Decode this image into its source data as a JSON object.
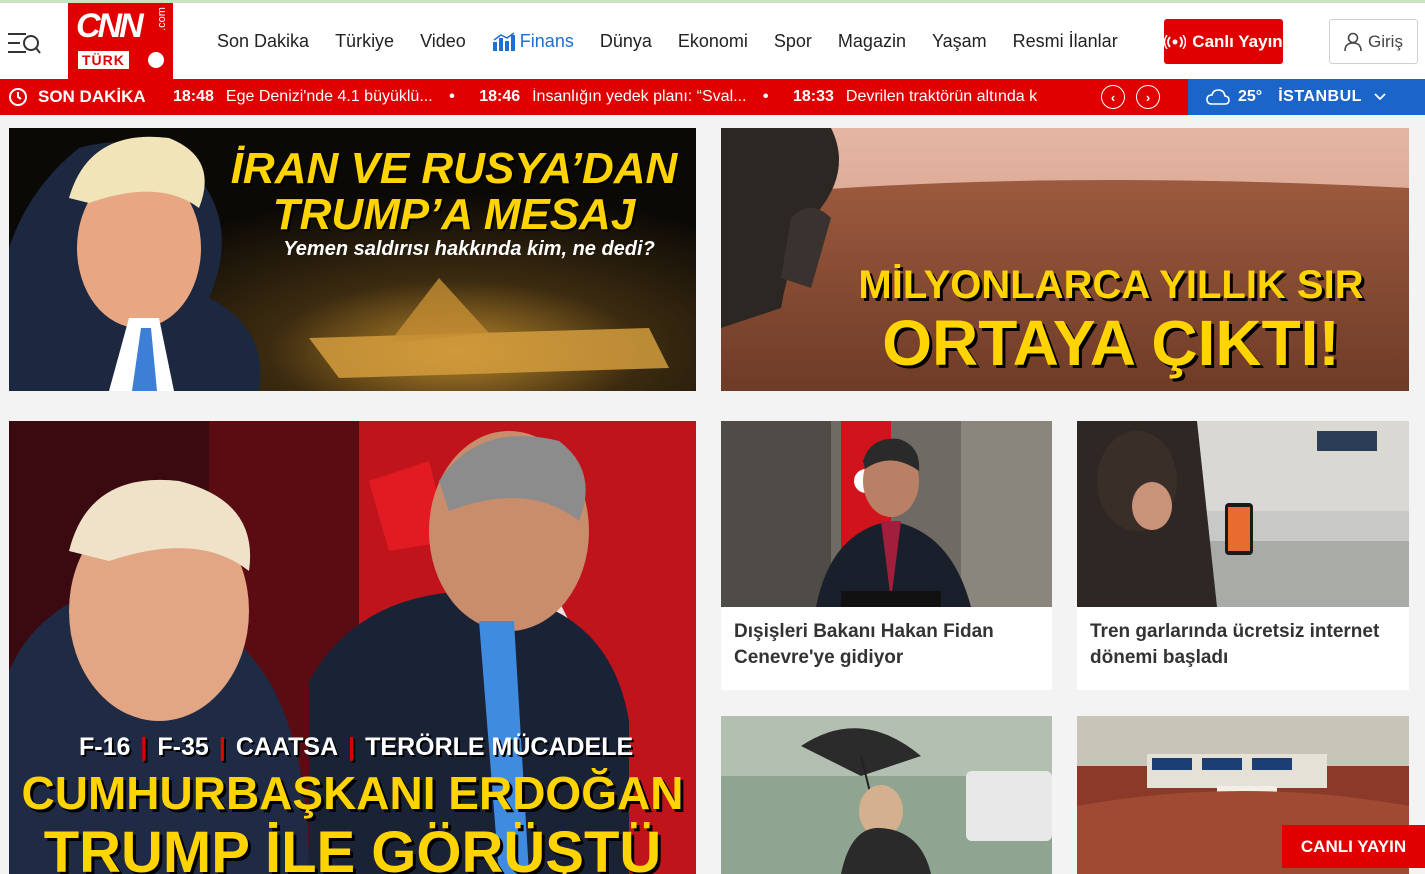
{
  "header": {
    "logo_main": "CNN",
    "logo_sub": "TÜRK",
    "logo_com": ".com",
    "nav": [
      {
        "label": "Son Dakika"
      },
      {
        "label": "Türkiye"
      },
      {
        "label": "Video"
      },
      {
        "label": "Finans"
      },
      {
        "label": "Dünya"
      },
      {
        "label": "Ekonomi"
      },
      {
        "label": "Spor"
      },
      {
        "label": "Magazin"
      },
      {
        "label": "Yaşam"
      },
      {
        "label": "Resmi İlanlar"
      }
    ],
    "live_label": "Canlı Yayın",
    "login_label": "Giriş"
  },
  "ticker": {
    "label": "SON DAKİKA",
    "items": [
      {
        "time": "18:48",
        "text": "Ege Denizi'nde 4.1 büyüklü..."
      },
      {
        "time": "18:46",
        "text": "İnsanlığın yedek planı: “Sval..."
      },
      {
        "time": "18:33",
        "text": "Devrilen traktörün altında k"
      }
    ],
    "separator": "•"
  },
  "weather": {
    "temp": "25°",
    "city": "İSTANBUL"
  },
  "banners": {
    "left": {
      "line1": "İRAN VE RUSYA’DAN",
      "line2": "TRUMP’A MESAJ",
      "line3": "Yemen saldırısı hakkında kim, ne dedi?"
    },
    "right": {
      "line1": "MİLYONLARCA YILLIK SIR",
      "line2": "ORTAYA ÇIKTI!"
    }
  },
  "main_story": {
    "tags": [
      "F-16",
      "F-35",
      "CAATSA",
      "TERÖRLE MÜCADELE"
    ],
    "line1": "CUMHURBAŞKANI ERDOĞAN",
    "line2": "TRUMP İLE GÖRÜŞTÜ"
  },
  "cards": [
    {
      "title": "Dışişleri Bakanı Hakan Fidan Cenevre'ye gidiyor"
    },
    {
      "title": "Tren garlarında ücretsiz internet dönemi başladı"
    }
  ],
  "float_live": "CANLI YAYIN",
  "colors": {
    "brand_red": "#e00000",
    "weather_blue": "#1b64c8",
    "finans_blue": "#1d6fd4",
    "headline_yellow": "#ffd400"
  }
}
